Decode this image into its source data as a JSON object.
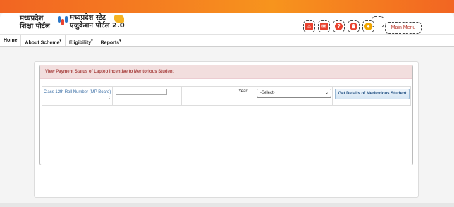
{
  "header": {
    "logo_left_line1": "मध्यप्रदेश",
    "logo_left_line2": "शिक्षा पोर्टल",
    "logo_right_line1": "मध्यप्रदेश स्टेट",
    "logo_right_line2": "एजुकेशन पोर्टल 2.0",
    "icons": [
      "home-icon",
      "mail-icon",
      "help-icon",
      "trophy-icon",
      "coin-icon"
    ],
    "main_menu_label": "Main Menu"
  },
  "nav": {
    "items": [
      {
        "label": "Home",
        "dropdown": false
      },
      {
        "label": "About Scheme",
        "dropdown": true
      },
      {
        "label": "Eligibility",
        "dropdown": true
      },
      {
        "label": "Reports",
        "dropdown": true
      }
    ]
  },
  "panel": {
    "title": "View Payment Status of Laptop Incentive to Meritorious Student",
    "roll_label": "Class 12th Roll Number (MP Board)",
    "roll_colon": ":",
    "roll_value": "",
    "year_label": "Year:",
    "year_selected": "-Select-",
    "submit_label": "Get Details of Meritorious Student"
  },
  "colors": {
    "banner": "#f26522",
    "panel_head_bg": "#f2dede",
    "panel_head_text": "#a94442",
    "button_text": "#1f4f82"
  }
}
